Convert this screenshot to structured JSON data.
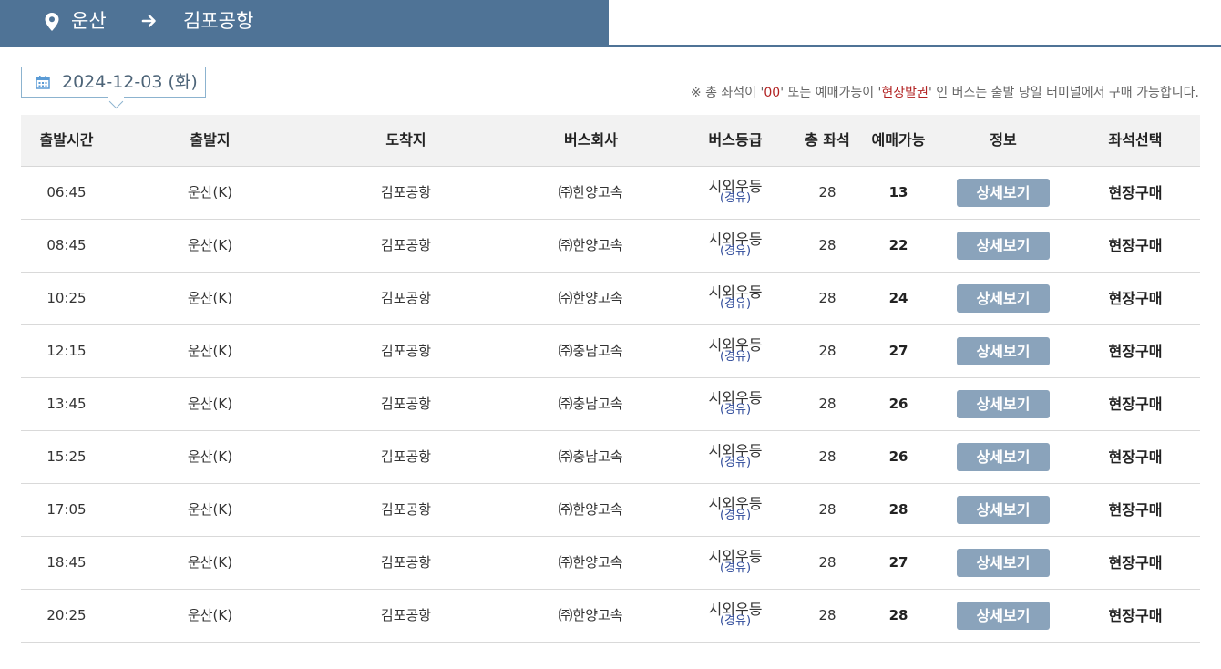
{
  "route": {
    "from": "운산",
    "to": "김포공항"
  },
  "date": {
    "label": "2024-12-03 (화)"
  },
  "notice": {
    "prefix": "※ 총 좌석이 '",
    "em1": "00",
    "mid": "' 또는 예매가능이 '",
    "em2": "현장발권",
    "suffix": "' 인 버스는 출발 당일 터미널에서 구매 가능합니다."
  },
  "headers": {
    "time": "출발시간",
    "from": "출발지",
    "to": "도착지",
    "company": "버스회사",
    "grade": "버스등급",
    "total": "총 좌석",
    "avail": "예매가능",
    "info": "정보",
    "seat": "좌석선택"
  },
  "rows": [
    {
      "time": "06:45",
      "from": "운산(K)",
      "to": "김포공항",
      "company": "㈜한양고속",
      "grade": "시외우등",
      "grade_sub": "(경유)",
      "total": "28",
      "avail": "13",
      "info": "상세보기",
      "seat": "현장구매"
    },
    {
      "time": "08:45",
      "from": "운산(K)",
      "to": "김포공항",
      "company": "㈜한양고속",
      "grade": "시외우등",
      "grade_sub": "(경유)",
      "total": "28",
      "avail": "22",
      "info": "상세보기",
      "seat": "현장구매"
    },
    {
      "time": "10:25",
      "from": "운산(K)",
      "to": "김포공항",
      "company": "㈜한양고속",
      "grade": "시외우등",
      "grade_sub": "(경유)",
      "total": "28",
      "avail": "24",
      "info": "상세보기",
      "seat": "현장구매"
    },
    {
      "time": "12:15",
      "from": "운산(K)",
      "to": "김포공항",
      "company": "㈜충남고속",
      "grade": "시외우등",
      "grade_sub": "(경유)",
      "total": "28",
      "avail": "27",
      "info": "상세보기",
      "seat": "현장구매"
    },
    {
      "time": "13:45",
      "from": "운산(K)",
      "to": "김포공항",
      "company": "㈜충남고속",
      "grade": "시외우등",
      "grade_sub": "(경유)",
      "total": "28",
      "avail": "26",
      "info": "상세보기",
      "seat": "현장구매"
    },
    {
      "time": "15:25",
      "from": "운산(K)",
      "to": "김포공항",
      "company": "㈜충남고속",
      "grade": "시외우등",
      "grade_sub": "(경유)",
      "total": "28",
      "avail": "26",
      "info": "상세보기",
      "seat": "현장구매"
    },
    {
      "time": "17:05",
      "from": "운산(K)",
      "to": "김포공항",
      "company": "㈜한양고속",
      "grade": "시외우등",
      "grade_sub": "(경유)",
      "total": "28",
      "avail": "28",
      "info": "상세보기",
      "seat": "현장구매"
    },
    {
      "time": "18:45",
      "from": "운산(K)",
      "to": "김포공항",
      "company": "㈜한양고속",
      "grade": "시외우등",
      "grade_sub": "(경유)",
      "total": "28",
      "avail": "27",
      "info": "상세보기",
      "seat": "현장구매"
    },
    {
      "time": "20:25",
      "from": "운산(K)",
      "to": "김포공항",
      "company": "㈜한양고속",
      "grade": "시외우등",
      "grade_sub": "(경유)",
      "total": "28",
      "avail": "28",
      "info": "상세보기",
      "seat": "현장구매"
    }
  ]
}
